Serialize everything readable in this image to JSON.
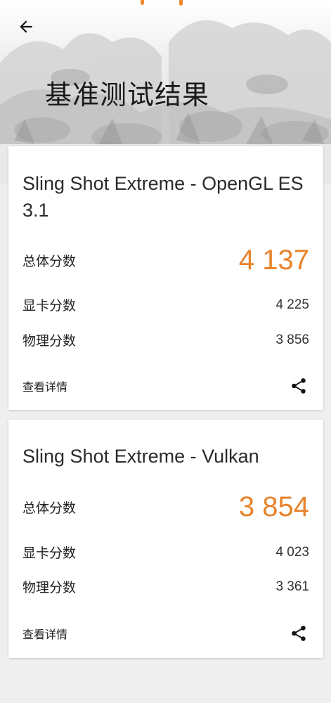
{
  "header": {
    "title": "基准测试结果"
  },
  "icons": {
    "back": "arrow-back-icon",
    "share": "share-icon"
  },
  "colors": {
    "accent": "#e8832b",
    "card": "#ffffff",
    "background": "#efefef"
  },
  "results": [
    {
      "title": "Sling Shot Extreme - OpenGL ES 3.1",
      "total_label": "总体分数",
      "total_value": "4 137",
      "gpu_label": "显卡分数",
      "gpu_value": "4 225",
      "physics_label": "物理分数",
      "physics_value": "3 856",
      "details_label": "查看详情"
    },
    {
      "title": "Sling Shot Extreme - Vulkan",
      "total_label": "总体分数",
      "total_value": "3 854",
      "gpu_label": "显卡分数",
      "gpu_value": "4 023",
      "physics_label": "物理分数",
      "physics_value": "3 361",
      "details_label": "查看详情"
    }
  ]
}
